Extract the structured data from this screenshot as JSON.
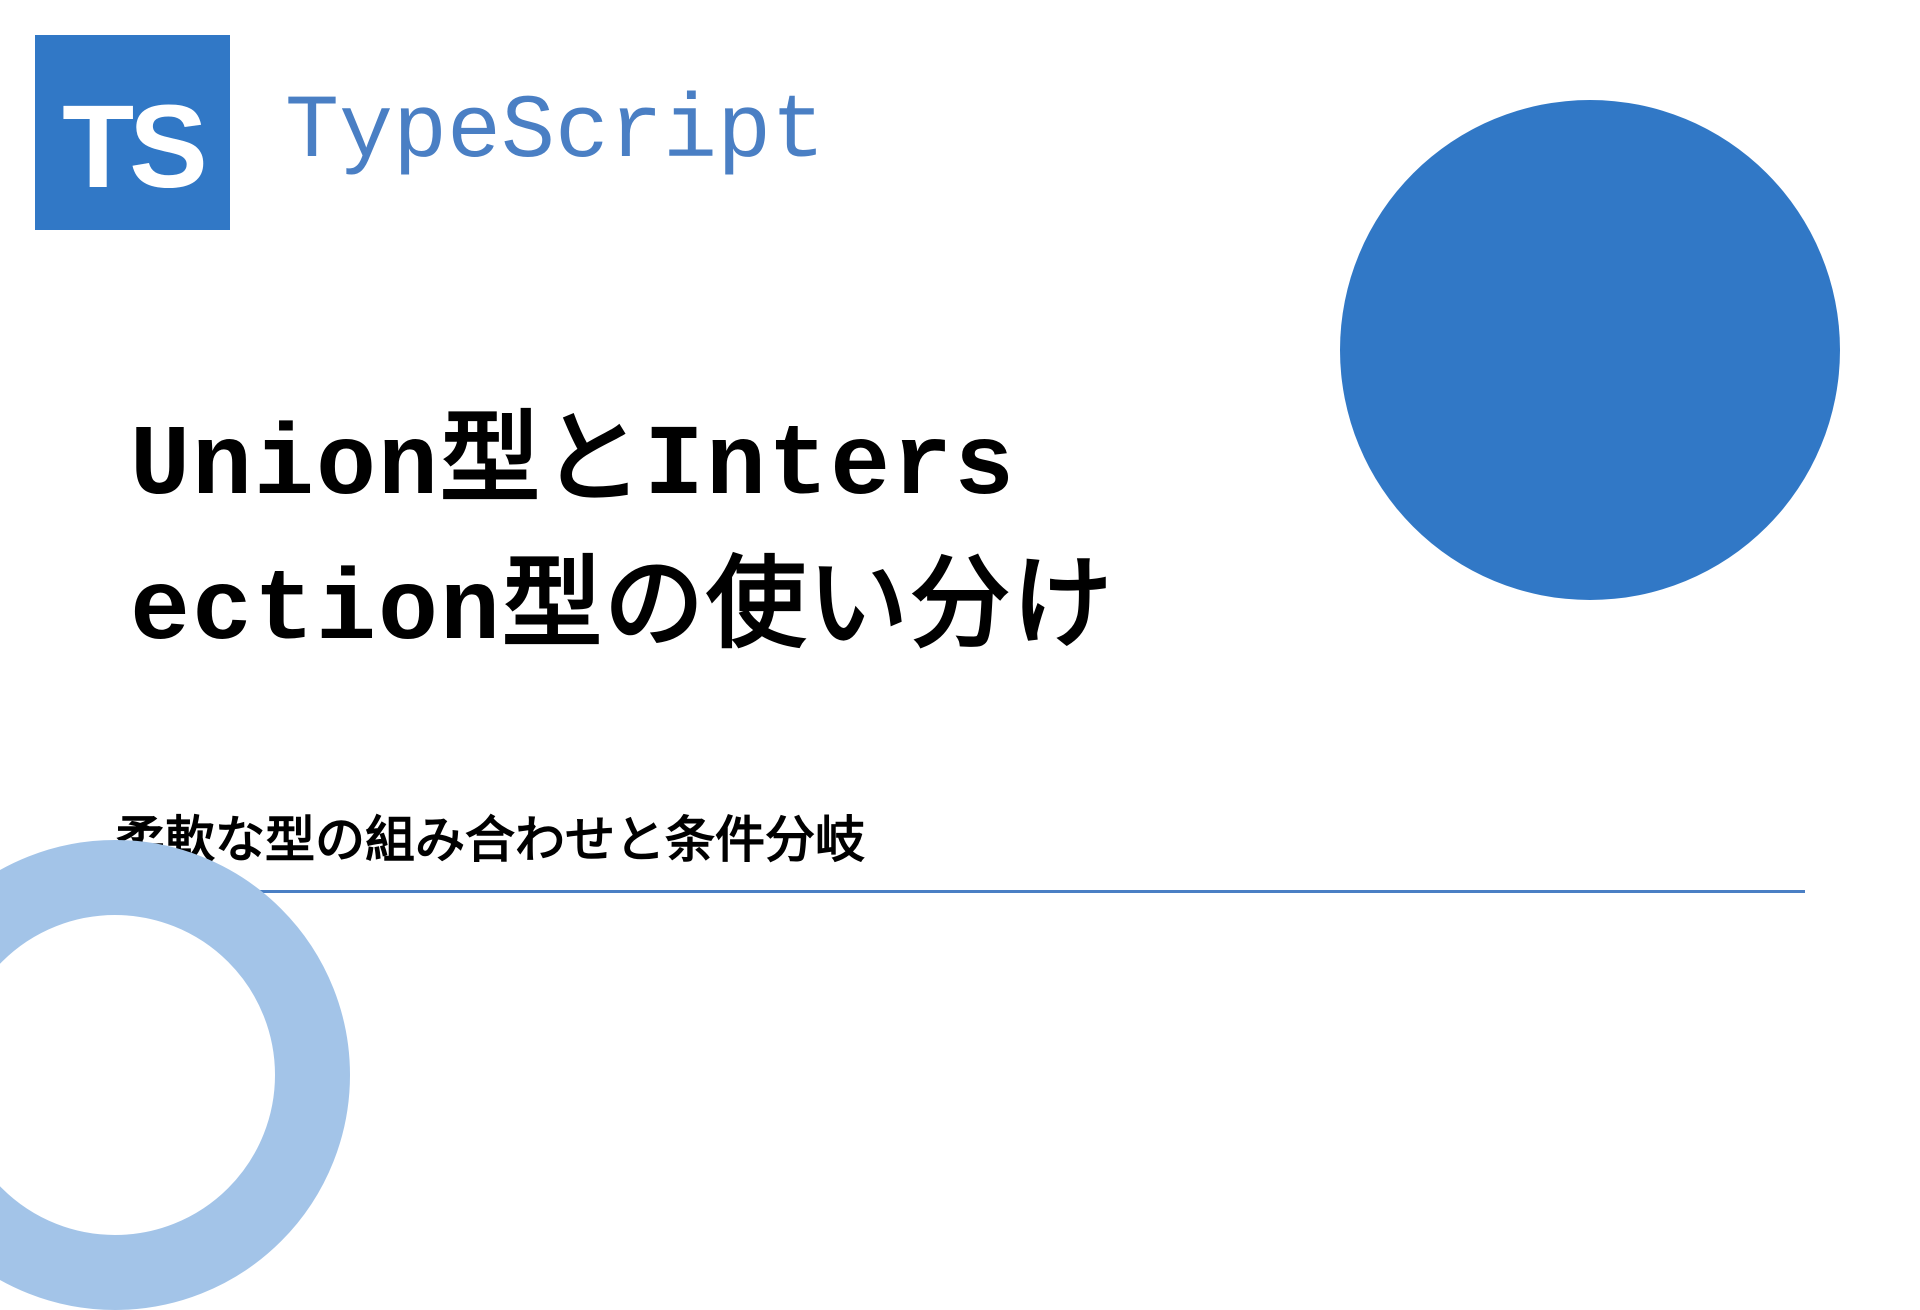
{
  "logo": {
    "text": "TS",
    "brand": "TypeScript"
  },
  "title": {
    "line1": "Union型とInters",
    "line2": "ection型の使い分け"
  },
  "subtitle": "柔軟な型の組み合わせと条件分岐",
  "colors": {
    "primary": "#3178c6",
    "accent": "#4a7fc4",
    "light": "#a3c4e8"
  }
}
